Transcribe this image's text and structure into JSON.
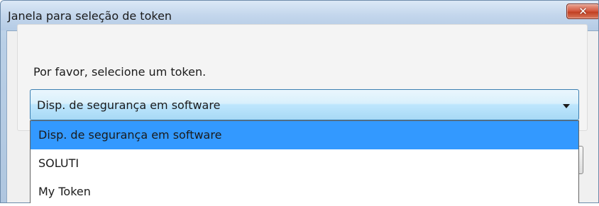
{
  "window": {
    "title": "Janela para seleção de token",
    "close_label": "✕"
  },
  "dialog": {
    "prompt": "Por favor, selecione um token.",
    "selected_value": "Disp. de segurança em software"
  },
  "dropdown": {
    "options": [
      "Disp. de segurança em software",
      "SOLUTI",
      "My Token"
    ],
    "highlighted_index": 0
  },
  "colors": {
    "highlight": "#3399ff",
    "close_button": "#c8452a",
    "combo_border": "#3c7fb1"
  }
}
